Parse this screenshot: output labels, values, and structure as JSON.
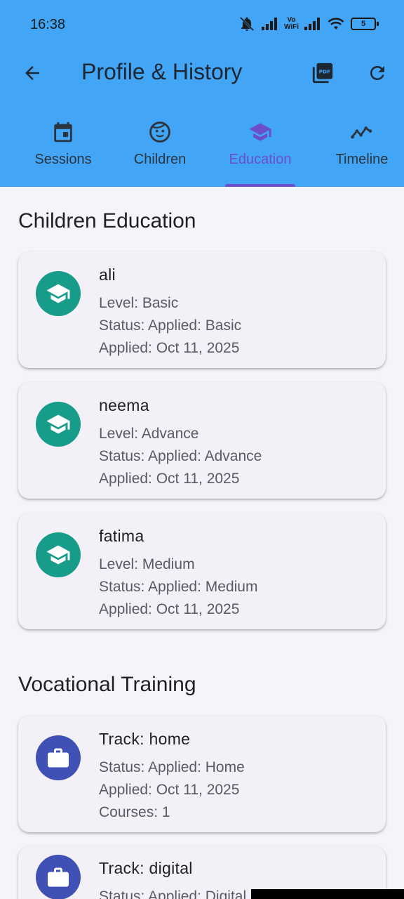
{
  "status_bar": {
    "time": "16:38",
    "volte_top": "Vo",
    "volte_bottom": "WiFi",
    "battery": "5"
  },
  "toolbar": {
    "title": "Profile & History"
  },
  "tabs": [
    {
      "label": "Sessions",
      "icon": "calendar-icon",
      "active": false
    },
    {
      "label": "Children",
      "icon": "face-icon",
      "active": false
    },
    {
      "label": "Education",
      "icon": "school-icon",
      "active": true
    },
    {
      "label": "Timeline",
      "icon": "timeline-icon",
      "active": false
    }
  ],
  "children_education": {
    "title": "Children Education",
    "items": [
      {
        "name": "ali",
        "level": "Level: Basic",
        "status": "Status: Applied: Basic",
        "applied": "Applied: Oct 11, 2025"
      },
      {
        "name": "neema",
        "level": "Level: Advance",
        "status": "Status: Applied: Advance",
        "applied": "Applied: Oct 11, 2025"
      },
      {
        "name": "fatima",
        "level": "Level: Medium",
        "status": "Status: Applied: Medium",
        "applied": "Applied: Oct 11, 2025"
      }
    ]
  },
  "vocational_training": {
    "title": "Vocational Training",
    "items": [
      {
        "track": "Track: home",
        "status": "Status: Applied: Home",
        "applied": "Applied: Oct 11, 2025",
        "courses": "Courses: 1"
      },
      {
        "track": "Track: digital",
        "status": "Status: Applied: Digital"
      }
    ]
  },
  "colors": {
    "appbar": "#42a5f5",
    "accent": "#6a4fc9",
    "education_avatar": "#169c89",
    "vocational_avatar": "#3f51b5"
  }
}
